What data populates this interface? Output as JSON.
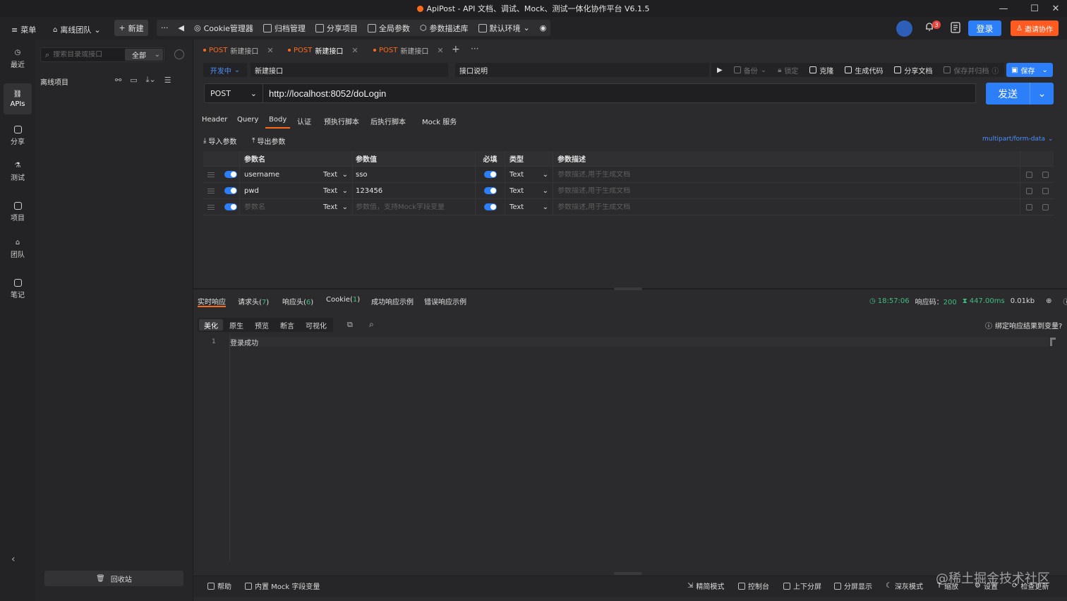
{
  "window": {
    "title": "ApiPost - API 文档、调试、Mock、测试一体化协作平台 V6.1.5",
    "minimize": "—",
    "maximize": "☐",
    "close": "✕"
  },
  "toolbar": {
    "menu": "菜单",
    "team": "离线团队",
    "new": "新建",
    "more": "···",
    "cookie": "Cookie管理器",
    "archive": "归档管理",
    "share_project": "分享项目",
    "global_params": "全局参数",
    "param_desc_lib": "参数描述库",
    "env": "默认环境",
    "notification_count": "3",
    "login": "登录",
    "invite": "邀请协作"
  },
  "nav": [
    {
      "label": "最近",
      "icon": "clock-icon"
    },
    {
      "label": "APIs",
      "icon": "link-icon"
    },
    {
      "label": "分享",
      "icon": "share-icon"
    },
    {
      "label": "测试",
      "icon": "test-icon"
    },
    {
      "label": "项目",
      "icon": "project-icon"
    },
    {
      "label": "团队",
      "icon": "team-icon"
    },
    {
      "label": "笔记",
      "icon": "note-icon"
    }
  ],
  "sidebar": {
    "search_placeholder": "搜索目录或接口",
    "filter": "全部",
    "project_title": "离线项目",
    "recycle": "回收站"
  },
  "tabs": [
    {
      "method": "POST",
      "name": "新建接口",
      "active": false
    },
    {
      "method": "POST",
      "name": "新建接口",
      "active": true
    },
    {
      "method": "POST",
      "name": "新建接口",
      "active": false
    }
  ],
  "request": {
    "status": "开发中",
    "name": "新建接口",
    "description": "接口说明",
    "method": "POST",
    "url": "http://localhost:8052/doLogin",
    "send": "发送"
  },
  "actions": {
    "backup": "备份",
    "lock": "锁定",
    "clone": "克隆",
    "gen_code": "生成代码",
    "share_doc": "分享文档",
    "save_exit": "保存并归档",
    "save": "保存"
  },
  "param_tabs": [
    "Header",
    "Query",
    "Body",
    "认证",
    "预执行脚本",
    "后执行脚本",
    "Mock 服务"
  ],
  "param_tabs_active": "Body",
  "body": {
    "import": "导入参数",
    "export": "导出参数",
    "content_type": "multipart/form-data",
    "headers": {
      "name": "参数名",
      "value": "参数值",
      "required": "必填",
      "type": "类型",
      "desc": "参数描述"
    },
    "rows": [
      {
        "name": "username",
        "type": "Text",
        "value": "sso",
        "required_type": "Text",
        "desc_placeholder": "参数描述,用于生成文档"
      },
      {
        "name": "pwd",
        "type": "Text",
        "value": "123456",
        "required_type": "Text",
        "desc_placeholder": "参数描述,用于生成文档"
      },
      {
        "name_placeholder": "参数名",
        "type": "Text",
        "value_placeholder": "参数值，支持Mock字段变量",
        "required_type": "Text",
        "desc_placeholder": "参数描述,用于生成文档"
      }
    ]
  },
  "response": {
    "tabs": [
      {
        "label": "实时响应",
        "count": ""
      },
      {
        "label": "请求头",
        "count": "7"
      },
      {
        "label": "响应头",
        "count": "6"
      },
      {
        "label": "Cookie",
        "count": "1"
      },
      {
        "label": "成功响应示例",
        "count": ""
      },
      {
        "label": "错误响应示例",
        "count": ""
      }
    ],
    "time": "18:57:06",
    "code_label": "响应码：",
    "code": "200",
    "duration": "447.00ms",
    "size": "0.01kb",
    "view_tabs": [
      "美化",
      "原生",
      "预览",
      "断言",
      "可视化"
    ],
    "bind_var": "绑定响应结果到变量?",
    "line_no": "1",
    "body": "登录成功"
  },
  "status": {
    "help": "帮助",
    "mock_fields": "内置 Mock 字段变量",
    "simple_mode": "精简模式",
    "console": "控制台",
    "split_vertical": "上下分屏",
    "split_display": "分屏显示",
    "dark_mode": "深灰模式",
    "zoom": "缩放",
    "settings": "设置",
    "check_update": "检查更新"
  },
  "watermark": "@稀土掘金技术社区"
}
